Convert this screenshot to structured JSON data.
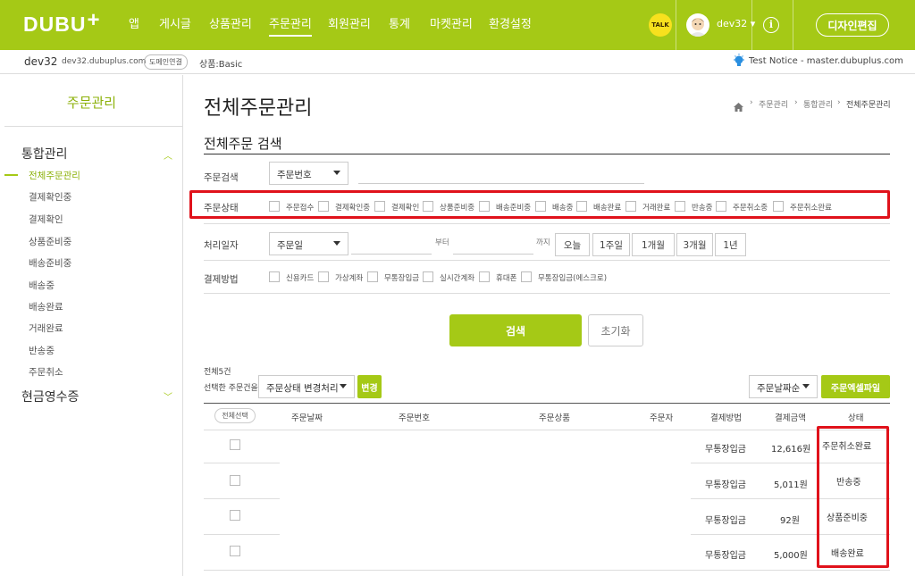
{
  "header": {
    "logo": "DUBU",
    "logo_plus": "+",
    "nav": [
      "앱",
      "게시글",
      "상품관리",
      "주문관리",
      "회원관리",
      "통계",
      "마켓관리",
      "환경설정"
    ],
    "talk_label": "TALK",
    "username": "dev32",
    "design_button": "디자인편집"
  },
  "infobar": {
    "site_name": "dev32",
    "domain": "dev32.dubuplus.com",
    "domain_button": "도메인연결",
    "product": "상품:Basic",
    "notice": "Test Notice - master.dubuplus.com"
  },
  "sidebar": {
    "title": "주문관리",
    "group1": "통합관리",
    "items": [
      "전체주문관리",
      "결제확인중",
      "결제확인",
      "상품준비중",
      "배송준비중",
      "배송중",
      "배송완료",
      "거래완료",
      "반송중",
      "주문취소"
    ],
    "group2": "현금영수증"
  },
  "page": {
    "title": "전체주문관리",
    "breadcrumb": [
      "주문관리",
      "통합관리",
      "전체주문관리"
    ],
    "search_title": "전체주문 검색"
  },
  "search": {
    "order_search_label": "주문검색",
    "order_search_select": "주문번호",
    "order_status_label": "주문상태",
    "order_status_options": [
      "주문접수",
      "결제확인중",
      "결제확인",
      "상품준비중",
      "배송준비중",
      "배송중",
      "배송완료",
      "거래완료",
      "반송중",
      "주문취소중",
      "주문취소완료"
    ],
    "process_date_label": "처리일자",
    "process_date_select": "주문일",
    "from_text": "부터",
    "to_text": "까지",
    "date_buttons": [
      "오늘",
      "1주일",
      "1개월",
      "3개월",
      "1년"
    ],
    "payment_label": "결제방법",
    "payment_options": [
      "신용카드",
      "가상계좌",
      "무통장입금",
      "실시간계좌",
      "휴대폰",
      "무통장입금(에스크로)"
    ],
    "search_button": "검색",
    "reset_button": "초기화"
  },
  "list": {
    "total": "전체5건",
    "selected_label": "선택한 주문건을",
    "bulk_select": "주문상태 변경처리",
    "change_button": "변경",
    "sort_select": "주문날짜순",
    "excel_button": "주문엑셀파일",
    "columns": [
      "전체선택",
      "주문날짜",
      "주문번호",
      "주문상품",
      "주문자",
      "결제방법",
      "결제금액",
      "상태"
    ],
    "rows": [
      {
        "payment": "무통장입금",
        "amount": "12,616원",
        "status": "주문취소완료"
      },
      {
        "payment": "무통장입금",
        "amount": "5,011원",
        "status": "반송중"
      },
      {
        "payment": "무통장입금",
        "amount": "92원",
        "status": "상품준비중"
      },
      {
        "payment": "무통장입금",
        "amount": "5,000원",
        "status": "배송완료"
      }
    ]
  },
  "colors": {
    "brand": "#a5c916",
    "highlight": "#e0121b"
  }
}
